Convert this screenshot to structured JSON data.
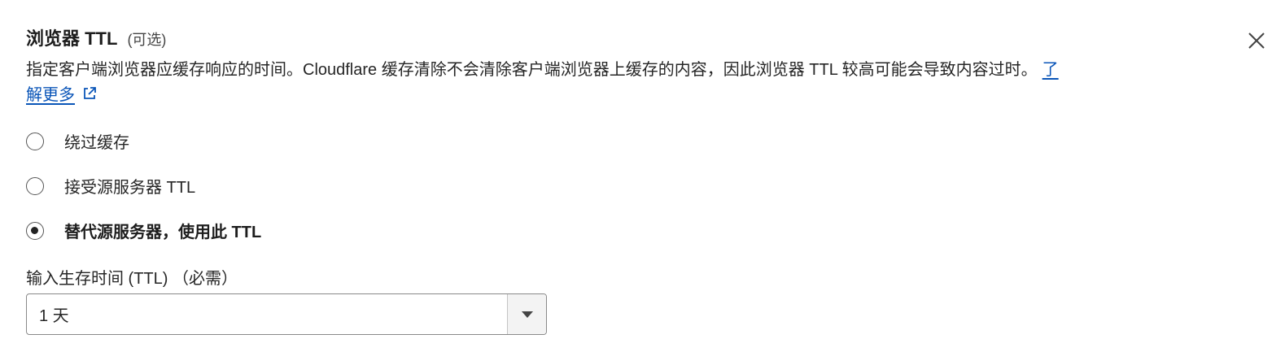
{
  "header": {
    "title": "浏览器 TTL",
    "optional": "(可选)"
  },
  "description": {
    "text": "指定客户端浏览器应缓存响应的时间。Cloudflare 缓存清除不会清除客户端浏览器上缓存的内容，因此浏览器 TTL 较高可能会导致内容过时。",
    "learn_more": "了解更多"
  },
  "options": [
    {
      "label": "绕过缓存",
      "selected": false
    },
    {
      "label": "接受源服务器 TTL",
      "selected": false
    },
    {
      "label": "替代源服务器，使用此 TTL",
      "selected": true
    }
  ],
  "ttl_field": {
    "label": "输入生存时间 (TTL) （必需）",
    "value": "1 天"
  },
  "icons": {
    "close": "close-icon",
    "external_link": "external-link-icon",
    "dropdown": "caret-down-icon"
  },
  "colors": {
    "link": "#0a55b8",
    "text": "#262626"
  }
}
